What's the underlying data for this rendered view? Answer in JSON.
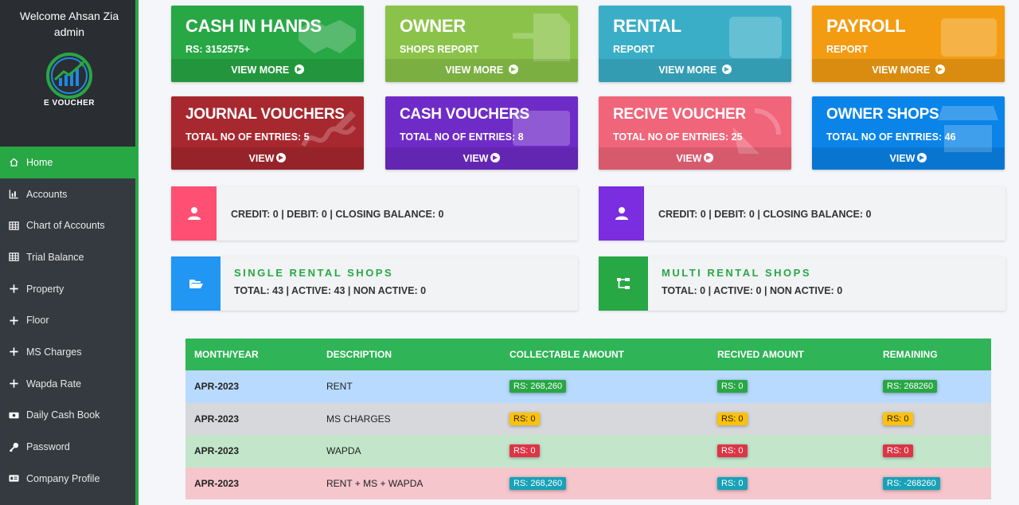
{
  "sidebar": {
    "welcome": "Welcome Ahsan Zia",
    "role": "admin",
    "logo_text": "E VOUCHER",
    "items": [
      {
        "label": "Home",
        "icon": "home-icon"
      },
      {
        "label": "Accounts",
        "icon": "chart-icon"
      },
      {
        "label": "Chart of Accounts",
        "icon": "table-icon"
      },
      {
        "label": "Trial Balance",
        "icon": "table-icon"
      },
      {
        "label": "Property",
        "icon": "plus-icon"
      },
      {
        "label": "Floor",
        "icon": "plus-icon"
      },
      {
        "label": "MS Charges",
        "icon": "plus-icon"
      },
      {
        "label": "Wapda Rate",
        "icon": "plus-icon"
      },
      {
        "label": "Daily Cash Book",
        "icon": "money-icon"
      },
      {
        "label": "Password",
        "icon": "key-icon"
      },
      {
        "label": "Company Profile",
        "icon": "id-card-icon"
      }
    ]
  },
  "boxes_top": [
    {
      "title": "CASH IN HANDS",
      "sub": "RS: 3152575+",
      "foot": "VIEW MORE",
      "color": "#28a745"
    },
    {
      "title": "OWNER",
      "sub": "SHOPS REPORT",
      "foot": "VIEW MORE",
      "color": "#8bc34a"
    },
    {
      "title": "RENTAL",
      "sub": "REPORT",
      "foot": "VIEW MORE",
      "color": "#3aaec7"
    },
    {
      "title": "PAYROLL",
      "sub": "REPORT",
      "foot": "VIEW MORE",
      "color": "#f39c12"
    }
  ],
  "boxes_second": [
    {
      "title": "JOURNAL VOUCHERS",
      "sub": "TOTAL NO OF ENTRIES: 5",
      "foot": "VIEW",
      "color": "#a8282f"
    },
    {
      "title": "CASH VOUCHERS",
      "sub": "TOTAL NO OF ENTRIES: 8",
      "foot": "VIEW",
      "color": "#6f2bc7"
    },
    {
      "title": "RECIVE VOUCHER",
      "sub": "TOTAL NO OF ENTRIES: 25",
      "foot": "VIEW",
      "color": "#f06579"
    },
    {
      "title": "OWNER SHOPS",
      "sub": "TOTAL NO OF ENTRIES: 46",
      "foot": "VIEW",
      "color": "#0a84e8"
    }
  ],
  "info_balance": [
    {
      "text": "CREDIT: 0 | DEBIT: 0 | CLOSING BALANCE: 0",
      "color": "#ff4f73"
    },
    {
      "text": "CREDIT: 0 | DEBIT: 0 | CLOSING BALANCE: 0",
      "color": "#7a2ee0"
    }
  ],
  "info_shops": [
    {
      "title": "SINGLE RENTAL SHOPS",
      "text": "TOTAL: 43 | ACTIVE: 43 | NON ACTIVE: 0",
      "color": "#2196f3"
    },
    {
      "title": "MULTI RENTAL SHOPS",
      "text": "TOTAL: 0 | ACTIVE: 0 | NON ACTIVE: 0",
      "color": "#28a745"
    }
  ],
  "table": {
    "headers": [
      "MONTH/YEAR",
      "DESCRIPTION",
      "COLLECTABLE AMOUNT",
      "RECIVED AMOUNT",
      "REMAINING"
    ],
    "rows": [
      [
        "APR-2023",
        "RENT",
        "RS: 268,260",
        "RS: 0",
        "RS: 268260"
      ],
      [
        "APR-2023",
        "MS CHARGES",
        "RS: 0",
        "RS: 0",
        "RS: 0"
      ],
      [
        "APR-2023",
        "WAPDA",
        "RS: 0",
        "RS: 0",
        "RS: 0"
      ],
      [
        "APR-2023",
        "RENT + MS + WAPDA",
        "RS: 268,260",
        "RS: 0",
        "RS: -268260"
      ]
    ]
  }
}
